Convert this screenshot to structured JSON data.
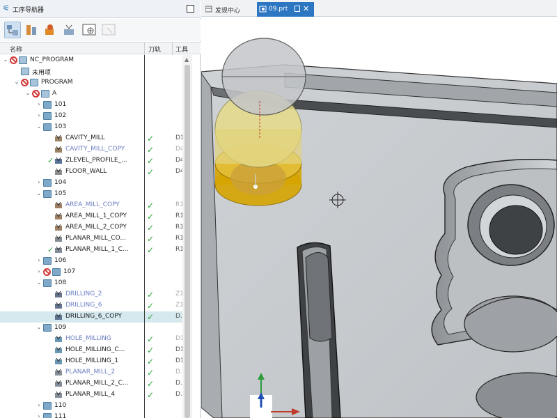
{
  "navigator": {
    "title": "工序导航器",
    "columns": {
      "name": "名称",
      "toolpath": "刀轨",
      "tool": "工具"
    }
  },
  "tabs": [
    {
      "label": "发现中心",
      "active": false
    },
    {
      "label": "09.prt",
      "active": true,
      "modified": true
    }
  ],
  "tree": [
    {
      "id": "nc_program",
      "label": "NC_PROGRAM",
      "level": 0,
      "expander": "-",
      "icon": "program",
      "status": "nogo"
    },
    {
      "id": "unused",
      "label": "未用项",
      "level": 1,
      "expander": "",
      "icon": "program"
    },
    {
      "id": "program",
      "label": "PROGRAM",
      "level": 1,
      "expander": "-",
      "icon": "program",
      "status": "nogo"
    },
    {
      "id": "a",
      "label": "A",
      "level": 2,
      "expander": "-",
      "icon": "program",
      "status": "nogo"
    },
    {
      "id": "g101",
      "label": "101",
      "level": 3,
      "expander": "+",
      "icon": "folder"
    },
    {
      "id": "g102",
      "label": "102",
      "level": 3,
      "expander": "+",
      "icon": "folder"
    },
    {
      "id": "g103",
      "label": "103",
      "level": 3,
      "expander": "-",
      "icon": "folder"
    },
    {
      "id": "op1",
      "label": "CAVITY_MILL",
      "level": 4,
      "icon": "op-cavity",
      "check": "✓",
      "tool": "D1"
    },
    {
      "id": "op2",
      "label": "CAVITY_MILL_COPY",
      "level": 4,
      "icon": "op-cavity",
      "check": "✓",
      "tool": "D4",
      "blue": true,
      "lightTool": true
    },
    {
      "id": "op3",
      "label": "ZLEVEL_PROFILE_...",
      "level": 4,
      "icon": "op-zlevel",
      "check": "✓",
      "tool": "D4",
      "leadCheck": true
    },
    {
      "id": "op4",
      "label": "FLOOR_WALL",
      "level": 4,
      "icon": "op-floor",
      "check": "✓",
      "tool": "D4"
    },
    {
      "id": "g104",
      "label": "104",
      "level": 3,
      "expander": "+",
      "icon": "folder"
    },
    {
      "id": "g105",
      "label": "105",
      "level": 3,
      "expander": "-",
      "icon": "folder"
    },
    {
      "id": "op5",
      "label": "AREA_MILL_COPY",
      "level": 4,
      "icon": "op-area",
      "check": "✓",
      "tool": "R1",
      "blue": true,
      "lightTool": true
    },
    {
      "id": "op6",
      "label": "AREA_MILL_1_COPY",
      "level": 4,
      "icon": "op-area",
      "check": "✓",
      "tool": "R1"
    },
    {
      "id": "op7",
      "label": "AREA_MILL_2_COPY",
      "level": 4,
      "icon": "op-area",
      "check": "✓",
      "tool": "R1"
    },
    {
      "id": "op8",
      "label": "PLANAR_MILL_CO...",
      "level": 4,
      "icon": "op-planar",
      "check": "✓",
      "tool": "R1"
    },
    {
      "id": "op9",
      "label": "PLANAR_MILL_1_C...",
      "level": 4,
      "icon": "op-planar",
      "check": "✓",
      "tool": "R1",
      "leadCheck": true
    },
    {
      "id": "g106",
      "label": "106",
      "level": 3,
      "expander": "+",
      "icon": "folder"
    },
    {
      "id": "g107",
      "label": "107",
      "level": 3,
      "expander": "+",
      "icon": "folder",
      "status": "nogo"
    },
    {
      "id": "g108",
      "label": "108",
      "level": 3,
      "expander": "-",
      "icon": "folder"
    },
    {
      "id": "op10",
      "label": "DRILLING_2",
      "level": 4,
      "icon": "op-drill",
      "check": "✓",
      "tool": "Z1",
      "blue": true,
      "lightTool": true
    },
    {
      "id": "op11",
      "label": "DRILLING_6",
      "level": 4,
      "icon": "op-drill",
      "check": "✓",
      "tool": "Z1",
      "blue": true,
      "lightTool": true
    },
    {
      "id": "op12",
      "label": "DRILLING_6_COPY",
      "level": 4,
      "icon": "op-drill",
      "check": "✓",
      "tool": "D.",
      "selected": true
    },
    {
      "id": "g109",
      "label": "109",
      "level": 3,
      "expander": "-",
      "icon": "folder"
    },
    {
      "id": "op13",
      "label": "HOLE_MILLING",
      "level": 4,
      "icon": "op-hole",
      "check": "✓",
      "tool": "D1",
      "blue": true,
      "lightTool": true
    },
    {
      "id": "op14",
      "label": "HOLE_MILLING_C...",
      "level": 4,
      "icon": "op-hole",
      "check": "✓",
      "tool": "D1"
    },
    {
      "id": "op15",
      "label": "HOLE_MILLING_1",
      "level": 4,
      "icon": "op-hole",
      "check": "✓",
      "tool": "D1"
    },
    {
      "id": "op16",
      "label": "PLANAR_MILL_2",
      "level": 4,
      "icon": "op-planar",
      "check": "✓",
      "tool": "D.",
      "blue": true,
      "lightTool": true
    },
    {
      "id": "op17",
      "label": "PLANAR_MILL_2_C...",
      "level": 4,
      "icon": "op-planar",
      "check": "✓",
      "tool": "D."
    },
    {
      "id": "op18",
      "label": "PLANAR_MILL_4",
      "level": 4,
      "icon": "op-planar",
      "check": "✓",
      "tool": "D."
    },
    {
      "id": "g110",
      "label": "110",
      "level": 3,
      "expander": "+",
      "icon": "folder"
    },
    {
      "id": "g111",
      "label": "111",
      "level": 3,
      "expander": "+",
      "icon": "folder"
    }
  ],
  "colors": {
    "tab_active": "#2d76c1",
    "check": "#2aa637",
    "nogo": "#d23a3a",
    "selected_row": "#d5e9ee",
    "inactive_label": "#6a7fc2",
    "tool_holder": "#c9a000"
  }
}
